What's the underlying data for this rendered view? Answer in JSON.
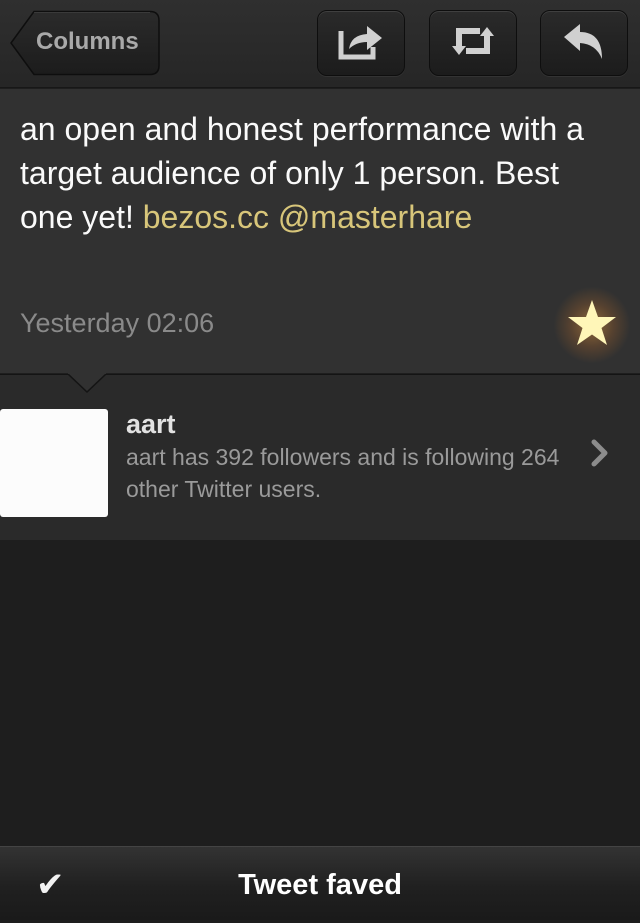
{
  "toolbar": {
    "back_label": "Columns",
    "buttons": [
      {
        "icon": "share-icon"
      },
      {
        "icon": "retweet-icon"
      },
      {
        "icon": "reply-icon"
      }
    ]
  },
  "tweet": {
    "text": "an open and honest performance with a target audience of only 1 person. Best one yet!",
    "link": "bezos.cc",
    "mention": "@masterhare",
    "timestamp": "Yesterday 02:06",
    "favorited": true,
    "star_color": "#fff6b8",
    "link_color": "#d8c67a"
  },
  "user": {
    "name": "aart",
    "description": "aart has 392 followers and is following 264 other Twitter users."
  },
  "status": {
    "icon": "checkmark-icon",
    "text": "Tweet faved"
  }
}
